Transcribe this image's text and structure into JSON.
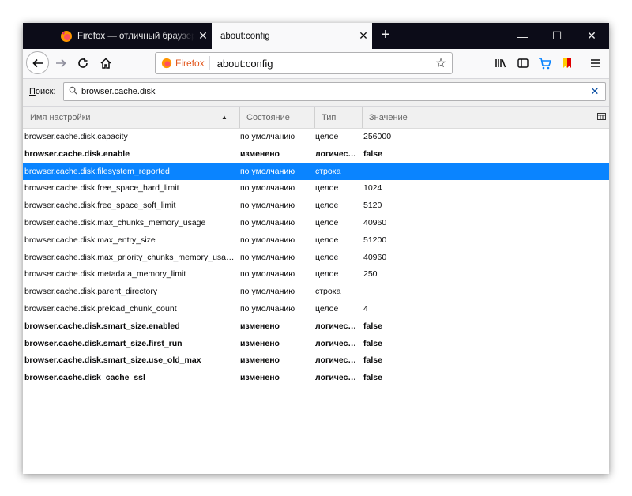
{
  "tabs": [
    {
      "title": "Firefox — отличный браузер для",
      "close": "✕"
    },
    {
      "title": "about:config",
      "close": "✕"
    }
  ],
  "window_controls": {
    "minimize": "—",
    "maximize": "☐",
    "close": "✕"
  },
  "toolbar": {
    "identity_label": "Firefox",
    "url": "about:config"
  },
  "search": {
    "label_prefix": "П",
    "label_rest": "оиск:",
    "value": "browser.cache.disk"
  },
  "columns": {
    "name": "Имя настройки",
    "state": "Состояние",
    "type": "Тип",
    "value": "Значение"
  },
  "rows": [
    {
      "name": "browser.cache.disk.capacity",
      "state": "по умолчанию",
      "type": "целое",
      "value": "256000",
      "bold": false
    },
    {
      "name": "browser.cache.disk.enable",
      "state": "изменено",
      "type": "логичес…",
      "value": "false",
      "bold": true
    },
    {
      "name": "browser.cache.disk.filesystem_reported",
      "state": "по умолчанию",
      "type": "строка",
      "value": "",
      "bold": false,
      "selected": true
    },
    {
      "name": "browser.cache.disk.free_space_hard_limit",
      "state": "по умолчанию",
      "type": "целое",
      "value": "1024",
      "bold": false
    },
    {
      "name": "browser.cache.disk.free_space_soft_limit",
      "state": "по умолчанию",
      "type": "целое",
      "value": "5120",
      "bold": false
    },
    {
      "name": "browser.cache.disk.max_chunks_memory_usage",
      "state": "по умолчанию",
      "type": "целое",
      "value": "40960",
      "bold": false
    },
    {
      "name": "browser.cache.disk.max_entry_size",
      "state": "по умолчанию",
      "type": "целое",
      "value": "51200",
      "bold": false
    },
    {
      "name": "browser.cache.disk.max_priority_chunks_memory_usa…",
      "state": "по умолчанию",
      "type": "целое",
      "value": "40960",
      "bold": false
    },
    {
      "name": "browser.cache.disk.metadata_memory_limit",
      "state": "по умолчанию",
      "type": "целое",
      "value": "250",
      "bold": false
    },
    {
      "name": "browser.cache.disk.parent_directory",
      "state": "по умолчанию",
      "type": "строка",
      "value": "",
      "bold": false
    },
    {
      "name": "browser.cache.disk.preload_chunk_count",
      "state": "по умолчанию",
      "type": "целое",
      "value": "4",
      "bold": false
    },
    {
      "name": "browser.cache.disk.smart_size.enabled",
      "state": "изменено",
      "type": "логичес…",
      "value": "false",
      "bold": true
    },
    {
      "name": "browser.cache.disk.smart_size.first_run",
      "state": "изменено",
      "type": "логичес…",
      "value": "false",
      "bold": true
    },
    {
      "name": "browser.cache.disk.smart_size.use_old_max",
      "state": "изменено",
      "type": "логичес…",
      "value": "false",
      "bold": true
    },
    {
      "name": "browser.cache.disk_cache_ssl",
      "state": "изменено",
      "type": "логичес…",
      "value": "false",
      "bold": true
    }
  ],
  "colors": {
    "selection": "#0a84ff",
    "titlebar": "#0c0c18",
    "firefox_orange": "#e25920"
  }
}
